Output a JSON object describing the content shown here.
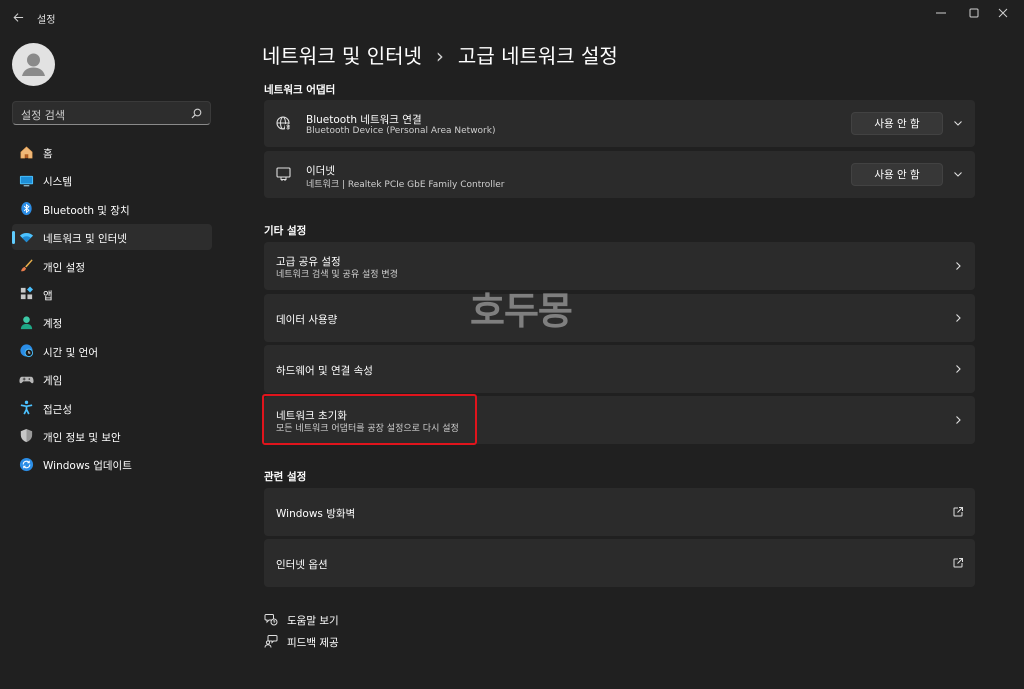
{
  "app": {
    "title": "설정"
  },
  "sidebar": {
    "search_placeholder": "설정 검색",
    "items": [
      {
        "label": "홈",
        "icon": "home-icon"
      },
      {
        "label": "시스템",
        "icon": "system-icon"
      },
      {
        "label": "Bluetooth 및 장치",
        "icon": "bluetooth-icon"
      },
      {
        "label": "네트워크 및 인터넷",
        "icon": "wifi-icon",
        "active": true
      },
      {
        "label": "개인 설정",
        "icon": "brush-icon"
      },
      {
        "label": "앱",
        "icon": "apps-icon"
      },
      {
        "label": "계정",
        "icon": "account-icon"
      },
      {
        "label": "시간 및 언어",
        "icon": "globe-icon"
      },
      {
        "label": "게임",
        "icon": "gamepad-icon"
      },
      {
        "label": "접근성",
        "icon": "accessibility-icon"
      },
      {
        "label": "개인 정보 및 보안",
        "icon": "shield-icon"
      },
      {
        "label": "Windows 업데이트",
        "icon": "update-icon"
      }
    ]
  },
  "breadcrumb": {
    "parent": "네트워크 및 인터넷",
    "separator": "›",
    "current": "고급 네트워크 설정"
  },
  "adapters": {
    "title": "네트워크 어댑터",
    "items": [
      {
        "name": "Bluetooth 네트워크 연결",
        "desc": "Bluetooth Device (Personal Area Network)",
        "button": "사용 안 함",
        "icon": "bluetooth-network-icon"
      },
      {
        "name": "이더넷",
        "desc": "네트워크 | Realtek PCIe GbE Family Controller",
        "button": "사용 안 함",
        "icon": "ethernet-icon"
      }
    ]
  },
  "more": {
    "title": "기타 설정",
    "items": [
      {
        "title": "고급 공유 설정",
        "sub": "네트워크 검색 및 공유 설정 변경"
      },
      {
        "title": "데이터 사용량",
        "sub": ""
      },
      {
        "title": "하드웨어 및 연결 속성",
        "sub": ""
      },
      {
        "title": "네트워크 초기화",
        "sub": "모든 네트워크 어댑터를 공장 설정으로 다시 설정"
      }
    ]
  },
  "related": {
    "title": "관련 설정",
    "items": [
      {
        "title": "Windows 방화벽"
      },
      {
        "title": "인터넷 옵션"
      }
    ]
  },
  "footer": {
    "help": "도움말 보기",
    "feedback": "피드백 제공"
  },
  "watermark": "호두몽",
  "colors": {
    "accent": "#60cdff",
    "highlight": "#e0141c",
    "background": "#202020",
    "card": "#2b2b2b"
  }
}
